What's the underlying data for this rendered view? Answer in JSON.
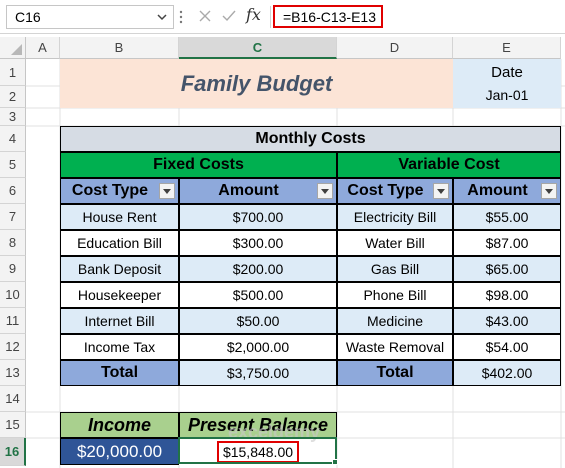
{
  "formula_bar": {
    "name_box": "C16",
    "fx_label": "fx",
    "formula": "=B16-C13-E13"
  },
  "columns": [
    "A",
    "B",
    "C",
    "D",
    "E"
  ],
  "rows": [
    "1",
    "2",
    "3",
    "4",
    "5",
    "6",
    "7",
    "8",
    "9",
    "10",
    "11",
    "12",
    "13",
    "14",
    "15",
    "16"
  ],
  "sheet": {
    "title": "Family Budget",
    "date_label": "Date",
    "date_value": "Jan-01",
    "monthly_costs": "Monthly Costs",
    "fixed_costs": "Fixed Costs",
    "variable_cost": "Variable Cost",
    "cost_type": "Cost Type",
    "amount": "Amount",
    "fixed_items": [
      {
        "type": "House Rent",
        "amount": "$700.00"
      },
      {
        "type": "Education Bill",
        "amount": "$300.00"
      },
      {
        "type": "Bank Deposit",
        "amount": "$200.00"
      },
      {
        "type": "Housekeeper",
        "amount": "$500.00"
      },
      {
        "type": "Internet Bill",
        "amount": "$50.00"
      },
      {
        "type": "Income Tax",
        "amount": "$2,000.00"
      }
    ],
    "variable_items": [
      {
        "type": "Electricity Bill",
        "amount": "$55.00"
      },
      {
        "type": "Water Bill",
        "amount": "$87.00"
      },
      {
        "type": "Gas Bill",
        "amount": "$65.00"
      },
      {
        "type": "Phone Bill",
        "amount": "$98.00"
      },
      {
        "type": "Medicine",
        "amount": "$43.00"
      },
      {
        "type": "Waste Removal",
        "amount": "$54.00"
      }
    ],
    "total_label": "Total",
    "fixed_total": "$3,750.00",
    "variable_total": "$402.00",
    "income_label": "Income",
    "income_value": "$20,000.00",
    "balance_label": "Present Balance",
    "balance_value": "$15,848.00",
    "watermark": "exceldemy"
  }
}
